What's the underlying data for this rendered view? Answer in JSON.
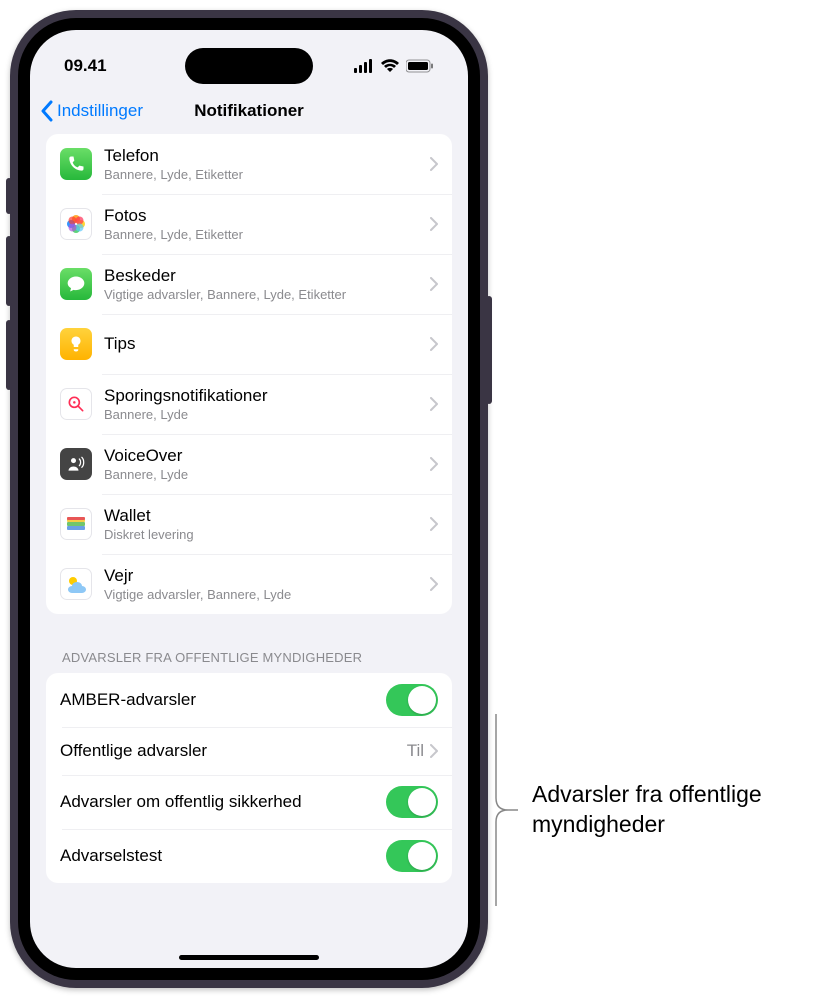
{
  "status": {
    "time": "09.41"
  },
  "nav": {
    "back": "Indstillinger",
    "title": "Notifikationer"
  },
  "apps": [
    {
      "name": "Telefon",
      "sub": "Bannere, Lyde, Etiketter",
      "iconClass": "ic-phone",
      "iconName": "phone-icon"
    },
    {
      "name": "Fotos",
      "sub": "Bannere, Lyde, Etiketter",
      "iconClass": "ic-photos",
      "iconName": "photos-icon"
    },
    {
      "name": "Beskeder",
      "sub": "Vigtige advarsler, Bannere, Lyde, Etiketter",
      "iconClass": "ic-messages",
      "iconName": "messages-icon"
    },
    {
      "name": "Tips",
      "sub": "",
      "iconClass": "ic-tips",
      "iconName": "tips-icon"
    },
    {
      "name": "Sporingsnotifikationer",
      "sub": "Bannere, Lyde",
      "iconClass": "ic-track",
      "iconName": "tracking-icon"
    },
    {
      "name": "VoiceOver",
      "sub": "Bannere, Lyde",
      "iconClass": "ic-voiceover",
      "iconName": "voiceover-icon"
    },
    {
      "name": "Wallet",
      "sub": "Diskret levering",
      "iconClass": "ic-wallet",
      "iconName": "wallet-icon"
    },
    {
      "name": "Vejr",
      "sub": "Vigtige advarsler, Bannere, Lyde",
      "iconClass": "ic-weather",
      "iconName": "weather-icon"
    }
  ],
  "section": {
    "header": "ADVARSLER FRA OFFENTLIGE MYNDIGHEDER"
  },
  "gov": [
    {
      "label": "AMBER-advarsler",
      "type": "switch",
      "on": true
    },
    {
      "label": "Offentlige advarsler",
      "type": "link",
      "value": "Til"
    },
    {
      "label": "Advarsler om offentlig sikkerhed",
      "type": "switch",
      "on": true
    },
    {
      "label": "Advarselstest",
      "type": "switch",
      "on": true
    }
  ],
  "callout": {
    "text": "Advarsler fra offentlige myndigheder"
  }
}
